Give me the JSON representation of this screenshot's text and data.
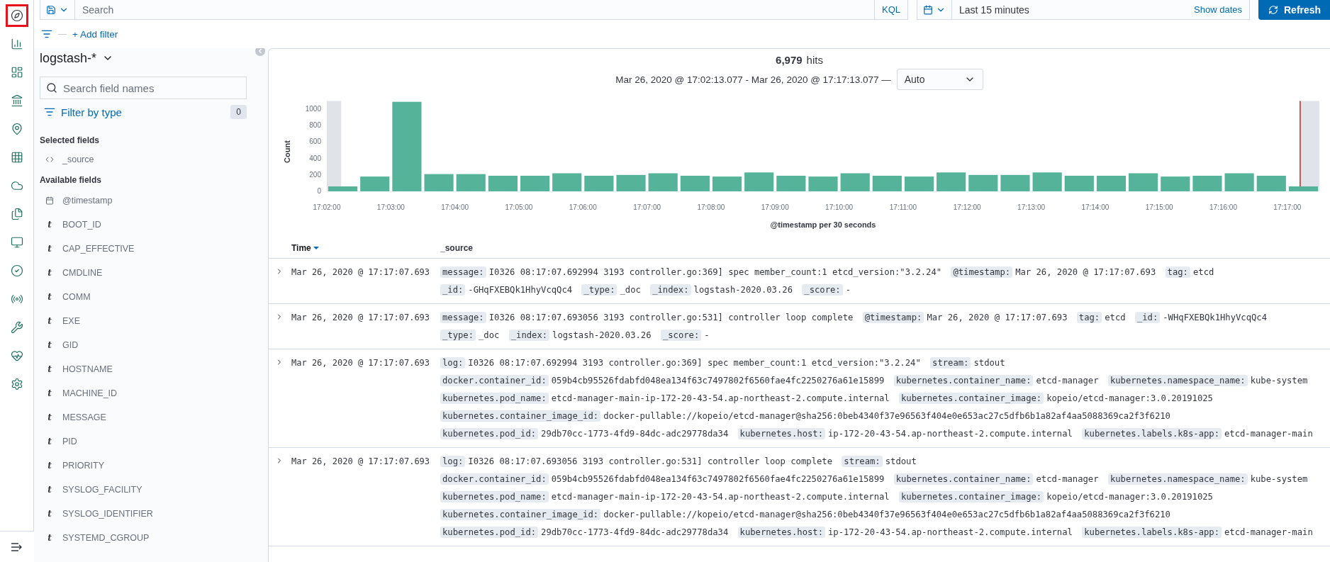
{
  "nav": {
    "items": [
      {
        "selected": true
      },
      {
        "selected": false
      },
      {
        "selected": false
      },
      {
        "selected": false
      },
      {
        "selected": false
      },
      {
        "selected": false
      },
      {
        "selected": false
      },
      {
        "selected": false
      },
      {
        "selected": false
      },
      {
        "selected": false
      },
      {
        "selected": false
      },
      {
        "selected": false
      },
      {
        "selected": false
      },
      {
        "selected": false
      }
    ]
  },
  "query_bar": {
    "placeholder": "Search",
    "language": "KQL",
    "time_range": "Last 15 minutes",
    "show_dates": "Show dates",
    "refresh": "Refresh"
  },
  "filter_bar": {
    "separator": "—",
    "add_filter": "+ Add filter"
  },
  "sidebar": {
    "index_pattern": "logstash-*",
    "search_placeholder": "Search field names",
    "filter_by_type": "Filter by type",
    "filter_count": "0",
    "selected_heading": "Selected fields",
    "selected_fields": [
      {
        "name": "_source",
        "kind": "source"
      }
    ],
    "available_heading": "Available fields",
    "available_fields": [
      {
        "name": "@timestamp",
        "kind": "date"
      },
      {
        "name": "BOOT_ID",
        "kind": "string",
        "type_label": "t"
      },
      {
        "name": "CAP_EFFECTIVE",
        "kind": "string",
        "type_label": "t"
      },
      {
        "name": "CMDLINE",
        "kind": "string",
        "type_label": "t"
      },
      {
        "name": "COMM",
        "kind": "string",
        "type_label": "t"
      },
      {
        "name": "EXE",
        "kind": "string",
        "type_label": "t"
      },
      {
        "name": "GID",
        "kind": "string",
        "type_label": "t"
      },
      {
        "name": "HOSTNAME",
        "kind": "string",
        "type_label": "t"
      },
      {
        "name": "MACHINE_ID",
        "kind": "string",
        "type_label": "t"
      },
      {
        "name": "MESSAGE",
        "kind": "string",
        "type_label": "t"
      },
      {
        "name": "PID",
        "kind": "string",
        "type_label": "t"
      },
      {
        "name": "PRIORITY",
        "kind": "string",
        "type_label": "t"
      },
      {
        "name": "SYSLOG_FACILITY",
        "kind": "string",
        "type_label": "t"
      },
      {
        "name": "SYSLOG_IDENTIFIER",
        "kind": "string",
        "type_label": "t"
      },
      {
        "name": "SYSTEMD_CGROUP",
        "kind": "string",
        "type_label": "t"
      }
    ]
  },
  "histogram": {
    "hits": "6,979",
    "hits_label": "hits",
    "range": "Mar 26, 2020 @ 17:02:13.077 - Mar 26, 2020 @ 17:17:13.077 —",
    "interval": "Auto",
    "chart_data": {
      "type": "bar",
      "xlabel": "@timestamp per 30 seconds",
      "ylabel": "Count",
      "categories": [
        "17:02:00",
        null,
        "17:03:00",
        null,
        "17:04:00",
        null,
        "17:05:00",
        null,
        "17:06:00",
        null,
        "17:07:00",
        null,
        "17:08:00",
        null,
        "17:09:00",
        null,
        "17:10:00",
        null,
        "17:11:00",
        null,
        "17:12:00",
        null,
        "17:13:00",
        null,
        "17:14:00",
        null,
        "17:15:00",
        null,
        "17:16:00",
        null,
        "17:17:00"
      ],
      "values": [
        60,
        180,
        1090,
        210,
        210,
        190,
        190,
        220,
        190,
        200,
        220,
        190,
        180,
        230,
        190,
        180,
        220,
        190,
        180,
        230,
        200,
        200,
        230,
        190,
        190,
        220,
        180,
        190,
        220,
        190,
        60
      ],
      "ylim": [
        0,
        1100
      ],
      "yticks": [
        0,
        200,
        400,
        600,
        800,
        1000
      ]
    }
  },
  "table": {
    "columns": [
      {
        "label": "Time",
        "sorted": true
      },
      {
        "label": "_source",
        "sorted": false
      }
    ],
    "rows": [
      {
        "expanded": false,
        "time": "Mar 26, 2020 @ 17:17:07.693",
        "fields": [
          {
            "key": "message:",
            "value": "I0326 08:17:07.692994 3193 controller.go:369] spec member_count:1 etcd_version:\"3.2.24\""
          },
          {
            "key": "@timestamp:",
            "value": "Mar 26, 2020 @ 17:17:07.693"
          },
          {
            "key": "tag:",
            "value": "etcd"
          },
          {
            "key": "_id:",
            "value": "-GHqFXEBQk1HhyVcqQc4"
          },
          {
            "key": "_type:",
            "value": "_doc"
          },
          {
            "key": "_index:",
            "value": "logstash-2020.03.26"
          },
          {
            "key": "_score:",
            "value": "-"
          }
        ]
      },
      {
        "expanded": false,
        "time": "Mar 26, 2020 @ 17:17:07.693",
        "fields": [
          {
            "key": "message:",
            "value": "I0326 08:17:07.693056 3193 controller.go:531] controller loop complete"
          },
          {
            "key": "@timestamp:",
            "value": "Mar 26, 2020 @ 17:17:07.693"
          },
          {
            "key": "tag:",
            "value": "etcd"
          },
          {
            "key": "_id:",
            "value": "-WHqFXEBQk1HhyVcqQc4"
          },
          {
            "key": "_type:",
            "value": "_doc"
          },
          {
            "key": "_index:",
            "value": "logstash-2020.03.26"
          },
          {
            "key": "_score:",
            "value": "-"
          }
        ]
      },
      {
        "expanded": false,
        "time": "Mar 26, 2020 @ 17:17:07.693",
        "fields": [
          {
            "key": "log:",
            "value": "I0326 08:17:07.692994 3193 controller.go:369] spec member_count:1 etcd_version:\"3.2.24\""
          },
          {
            "key": "stream:",
            "value": "stdout"
          },
          {
            "key": "docker.container_id:",
            "value": "059b4cb95526fdabfd048ea134f63c7497802f6560fae4fc2250276a61e15899"
          },
          {
            "key": "kubernetes.container_name:",
            "value": "etcd-manager"
          },
          {
            "key": "kubernetes.namespace_name:",
            "value": "kube-system"
          },
          {
            "key": "kubernetes.pod_name:",
            "value": "etcd-manager-main-ip-172-20-43-54.ap-northeast-2.compute.internal"
          },
          {
            "key": "kubernetes.container_image:",
            "value": "kopeio/etcd-manager:3.0.20191025"
          },
          {
            "key": "kubernetes.container_image_id:",
            "value": "docker-pullable://kopeio/etcd-manager@sha256:0beb4340f37e96563f404e0e653ac27c5dfb6b1a82af4aa5088369ca2f3f6210"
          },
          {
            "key": "kubernetes.pod_id:",
            "value": "29db70cc-1773-4fd9-84dc-adc29778da34"
          },
          {
            "key": "kubernetes.host:",
            "value": "ip-172-20-43-54.ap-northeast-2.compute.internal"
          },
          {
            "key": "kubernetes.labels.k8s-app:",
            "value": "etcd-manager-main"
          }
        ]
      },
      {
        "expanded": false,
        "time": "Mar 26, 2020 @ 17:17:07.693",
        "fields": [
          {
            "key": "log:",
            "value": "I0326 08:17:07.693056 3193 controller.go:531] controller loop complete"
          },
          {
            "key": "stream:",
            "value": "stdout"
          },
          {
            "key": "docker.container_id:",
            "value": "059b4cb95526fdabfd048ea134f63c7497802f6560fae4fc2250276a61e15899"
          },
          {
            "key": "kubernetes.container_name:",
            "value": "etcd-manager"
          },
          {
            "key": "kubernetes.namespace_name:",
            "value": "kube-system"
          },
          {
            "key": "kubernetes.pod_name:",
            "value": "etcd-manager-main-ip-172-20-43-54.ap-northeast-2.compute.internal"
          },
          {
            "key": "kubernetes.container_image:",
            "value": "kopeio/etcd-manager:3.0.20191025"
          },
          {
            "key": "kubernetes.container_image_id:",
            "value": "docker-pullable://kopeio/etcd-manager@sha256:0beb4340f37e96563f404e0e653ac27c5dfb6b1a82af4aa5088369ca2f3f6210"
          },
          {
            "key": "kubernetes.pod_id:",
            "value": "29db70cc-1773-4fd9-84dc-adc29778da34"
          },
          {
            "key": "kubernetes.host:",
            "value": "ip-172-20-43-54.ap-northeast-2.compute.internal"
          },
          {
            "key": "kubernetes.labels.k8s-app:",
            "value": "etcd-manager-main"
          }
        ]
      }
    ]
  }
}
